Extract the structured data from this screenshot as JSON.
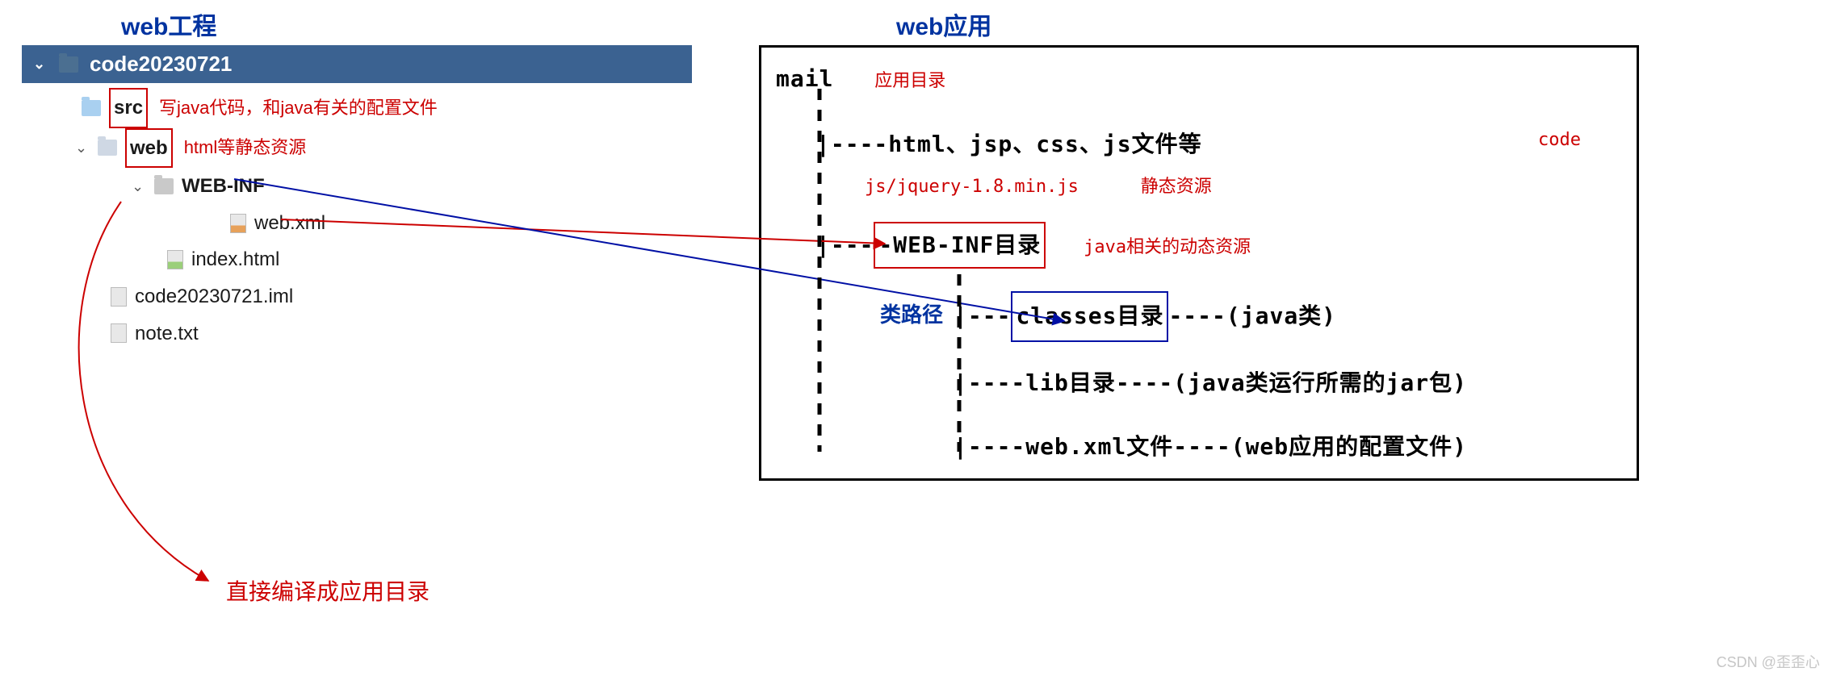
{
  "labels": {
    "leftTitle": "web工程",
    "rightTitle": "web应用"
  },
  "project": {
    "name": "code20230721",
    "src": {
      "label": "src",
      "note": "写java代码，和java有关的配置文件"
    },
    "web": {
      "label": "web",
      "note": "html等静态资源"
    },
    "webinf": {
      "label": "WEB-INF"
    },
    "webxml": {
      "label": "web.xml"
    },
    "indexhtml": {
      "label": "index.html"
    },
    "iml": {
      "label": "code20230721.iml"
    },
    "notetxt": {
      "label": "note.txt"
    },
    "compileNote": "直接编译成应用目录"
  },
  "right": {
    "mail": "mail",
    "code": "code",
    "appdir": "应用目录",
    "line_static": "|----html、jsp、css、js文件等",
    "staticNote1": "js/jquery-1.8.min.js",
    "staticNote2": "静态资源",
    "line_webinf_prefix": "|---",
    "webinf_box": "-WEB-INF目录",
    "webinf_note": "java相关的动态资源",
    "classpath": "类路径",
    "line_classes_prefix": "|---",
    "classes_box": "classes目录",
    "classes_suffix": "----(java类)",
    "line_lib": "|----lib目录----(java类运行所需的jar包)",
    "line_webxml": "|----web.xml文件----(web应用的配置文件)"
  },
  "watermark": "CSDN @歪歪心"
}
